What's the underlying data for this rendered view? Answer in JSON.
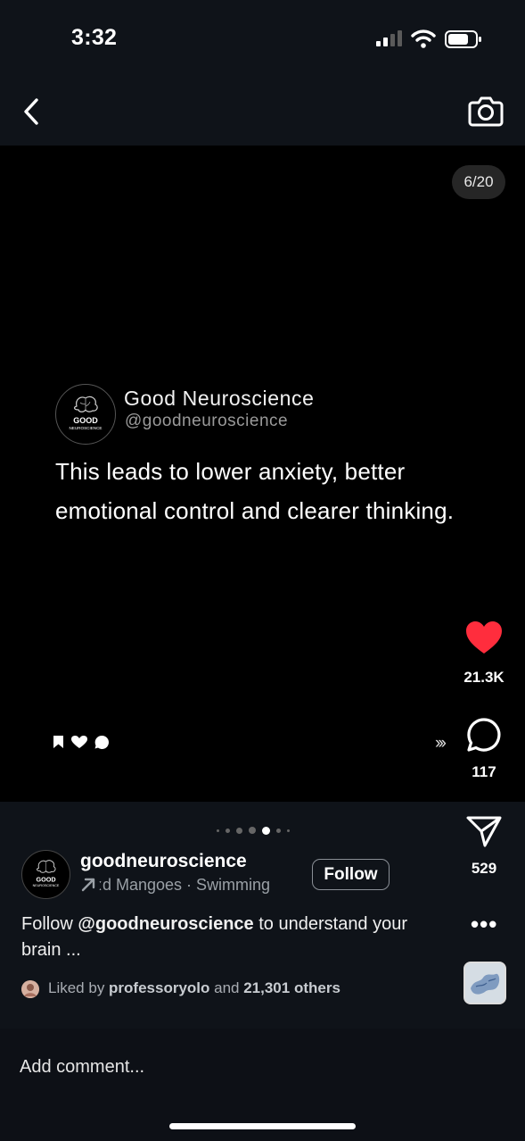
{
  "status_bar": {
    "time": "3:32"
  },
  "media": {
    "counter": "6/20",
    "post_card": {
      "avatar_text_top": "GOOD",
      "avatar_text_bottom": "NEUROSCIENCE",
      "name": "Good Neuroscience",
      "handle": "@goodneuroscience",
      "text": "This leads to lower anxiety, better emotional control and clearer thinking."
    }
  },
  "actions": {
    "likes": "21.3K",
    "comments": "117",
    "shares": "529",
    "chevrons": "›››",
    "more": "•••"
  },
  "carousel": {
    "dot_count": 7,
    "active_index": 4
  },
  "author": {
    "username": "goodneuroscience",
    "avatar_text_top": "GOOD",
    "avatar_text_bottom": "NEUROSCIENCE",
    "music": "ːd Mangoes · Swimming",
    "follow_label": "Follow"
  },
  "caption": {
    "prefix": "Follow ",
    "mention": "@goodneuroscience",
    "suffix": " to understand your brain ..."
  },
  "liked_by": {
    "prefix": "Liked by ",
    "user": "professoryolo",
    "middle": " and ",
    "others": "21,301 others"
  },
  "comment_bar": {
    "placeholder": "Add comment..."
  },
  "colors": {
    "like_red": "#ff2d3d",
    "background": "#0f1319",
    "media_bg": "#000000"
  }
}
